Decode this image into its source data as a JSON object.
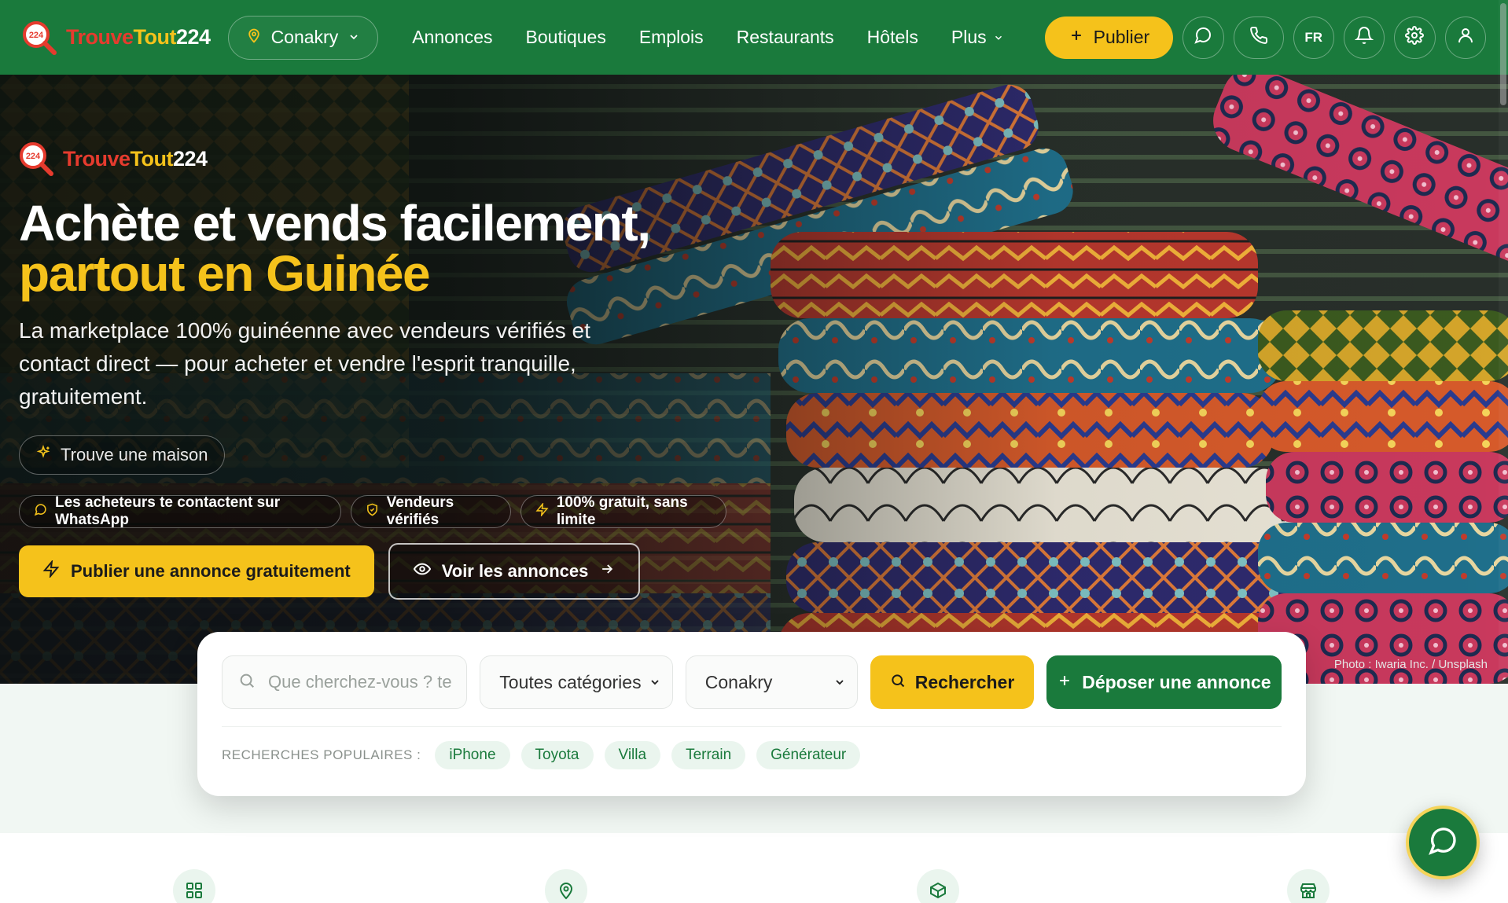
{
  "brand": {
    "part1": "Trouve",
    "part2": "Tout",
    "part3": "224",
    "badge_number": "224"
  },
  "nav": {
    "city": "Conakry",
    "links": [
      "Annonces",
      "Boutiques",
      "Emplois",
      "Restaurants",
      "Hôtels"
    ],
    "more_label": "Plus",
    "publish_label": "Publier",
    "lang": "FR"
  },
  "hero": {
    "headline_line1": "Achète et vends facilement,",
    "headline_line2": "partout en Guinée",
    "subtitle": "La marketplace 100% guinéenne avec vendeurs vérifiés et contact direct — pour acheter et vendre l'esprit tranquille, gratuitement.",
    "typing_hint": "Trouve une maison",
    "badges": [
      "Les acheteurs te contactent sur WhatsApp",
      "Vendeurs vérifiés",
      "100% gratuit, sans limite"
    ],
    "cta_primary": "Publier une annonce gratuitement",
    "cta_secondary": "Voir les annonces",
    "photo_credit": "Photo : Iwaria Inc. / Unsplash"
  },
  "search": {
    "placeholder": "Que cherchez-vous ? te",
    "category": "Toutes catégories",
    "city": "Conakry",
    "search_label": "Rechercher",
    "deposit_label": "Déposer une annonce",
    "popular_label": "RECHERCHES POPULAIRES :",
    "popular": [
      "iPhone",
      "Toyota",
      "Villa",
      "Terrain",
      "Générateur"
    ]
  },
  "features": {
    "icons": [
      "grid-icon",
      "map-pin-icon",
      "package-icon",
      "store-icon"
    ]
  },
  "colors": {
    "primary_green": "#1a7a3c",
    "accent_yellow": "#f5c21b",
    "brand_red": "#e63b2e"
  }
}
